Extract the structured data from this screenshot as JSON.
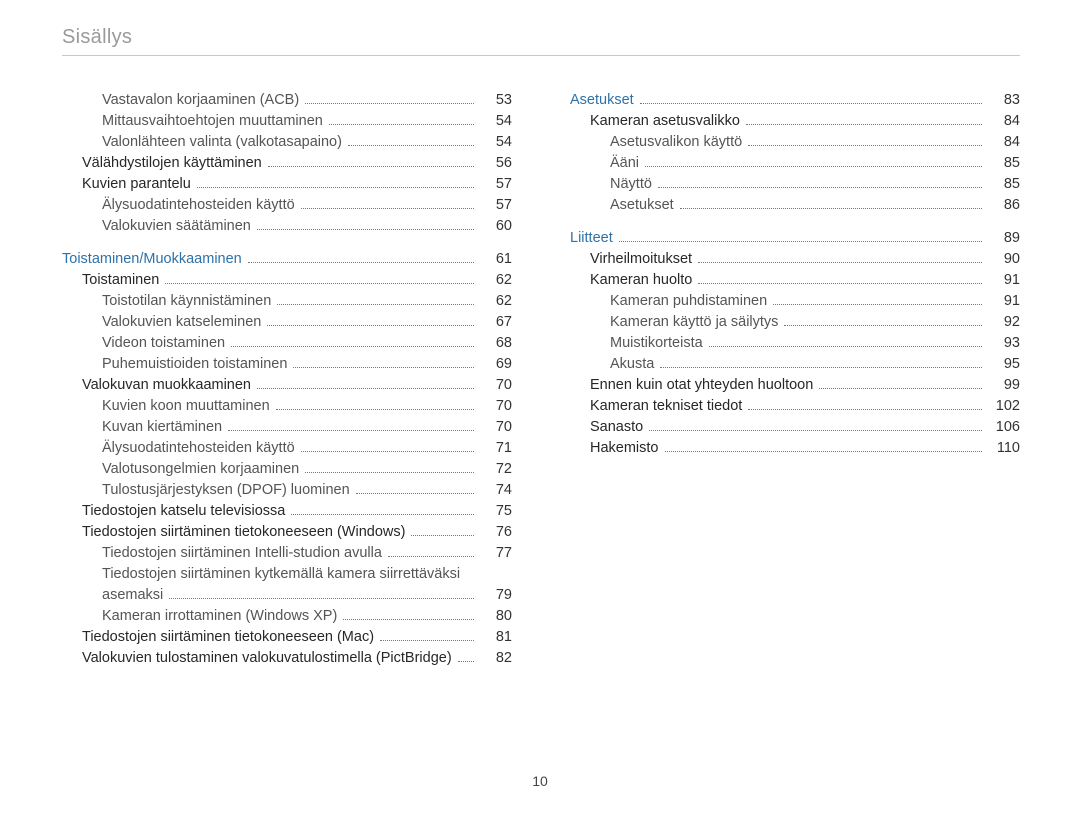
{
  "header": "Sisällys",
  "page_number": "10",
  "left": [
    {
      "level": 2,
      "label": "Vastavalon korjaaminen (ACB)",
      "page": "53"
    },
    {
      "level": 2,
      "label": "Mittausvaihtoehtojen muuttaminen",
      "page": "54"
    },
    {
      "level": 2,
      "label": "Valonlähteen valinta (valkotasapaino)",
      "page": "54"
    },
    {
      "level": 1,
      "label": "Välähdystilojen käyttäminen",
      "page": "56"
    },
    {
      "level": 1,
      "label": "Kuvien parantelu",
      "page": "57"
    },
    {
      "level": 2,
      "label": "Älysuodatintehosteiden käyttö",
      "page": "57"
    },
    {
      "level": 2,
      "label": "Valokuvien säätäminen",
      "page": "60"
    },
    {
      "spacer": true
    },
    {
      "level": 0,
      "section": true,
      "label": "Toistaminen/Muokkaaminen",
      "page": "61"
    },
    {
      "level": 1,
      "label": "Toistaminen",
      "page": "62"
    },
    {
      "level": 2,
      "label": "Toistotilan käynnistäminen",
      "page": "62"
    },
    {
      "level": 2,
      "label": "Valokuvien katseleminen",
      "page": "67"
    },
    {
      "level": 2,
      "label": "Videon toistaminen",
      "page": "68"
    },
    {
      "level": 2,
      "label": "Puhemuistioiden toistaminen",
      "page": "69"
    },
    {
      "level": 1,
      "label": "Valokuvan muokkaaminen",
      "page": "70"
    },
    {
      "level": 2,
      "label": "Kuvien koon muuttaminen",
      "page": "70"
    },
    {
      "level": 2,
      "label": "Kuvan kiertäminen",
      "page": "70"
    },
    {
      "level": 2,
      "label": "Älysuodatintehosteiden käyttö",
      "page": "71"
    },
    {
      "level": 2,
      "label": "Valotusongelmien korjaaminen",
      "page": "72"
    },
    {
      "level": 2,
      "label": "Tulostusjärjestyksen (DPOF) luominen",
      "page": "74"
    },
    {
      "level": 1,
      "label": "Tiedostojen katselu televisiossa",
      "page": "75"
    },
    {
      "level": 1,
      "label": "Tiedostojen siirtäminen tietokoneeseen (Windows)",
      "page": "76"
    },
    {
      "level": 2,
      "label": "Tiedostojen siirtäminen Intelli-studion avulla",
      "page": "77"
    },
    {
      "level": 2,
      "nopage": true,
      "label": "Tiedostojen siirtäminen kytkemällä kamera siirrettäväksi"
    },
    {
      "level": 2,
      "label": "asemaksi",
      "page": "79"
    },
    {
      "level": 2,
      "label": "Kameran irrottaminen (Windows XP)",
      "page": "80"
    },
    {
      "level": 1,
      "label": "Tiedostojen siirtäminen tietokoneeseen (Mac)",
      "page": "81"
    },
    {
      "level": 1,
      "label": "Valokuvien tulostaminen valokuvatulostimella (PictBridge)",
      "page": "82"
    }
  ],
  "right": [
    {
      "level": 0,
      "section": true,
      "label": "Asetukset",
      "page": "83"
    },
    {
      "level": 1,
      "label": "Kameran asetusvalikko",
      "page": "84"
    },
    {
      "level": 2,
      "label": "Asetusvalikon käyttö",
      "page": "84"
    },
    {
      "level": 2,
      "label": "Ääni",
      "page": "85"
    },
    {
      "level": 2,
      "label": "Näyttö",
      "page": "85"
    },
    {
      "level": 2,
      "label": "Asetukset",
      "page": "86"
    },
    {
      "spacer": true
    },
    {
      "level": 0,
      "section": true,
      "label": "Liitteet",
      "page": "89"
    },
    {
      "level": 1,
      "label": "Virheilmoitukset",
      "page": "90"
    },
    {
      "level": 1,
      "label": "Kameran huolto",
      "page": "91"
    },
    {
      "level": 2,
      "label": "Kameran puhdistaminen",
      "page": "91"
    },
    {
      "level": 2,
      "label": "Kameran käyttö ja säilytys",
      "page": "92"
    },
    {
      "level": 2,
      "label": "Muistikorteista",
      "page": "93"
    },
    {
      "level": 2,
      "label": "Akusta",
      "page": "95"
    },
    {
      "level": 1,
      "label": "Ennen kuin otat yhteyden huoltoon",
      "page": "99"
    },
    {
      "level": 1,
      "label": "Kameran tekniset tiedot",
      "page": "102"
    },
    {
      "level": 1,
      "label": "Sanasto",
      "page": "106"
    },
    {
      "level": 1,
      "label": "Hakemisto",
      "page": "110"
    }
  ]
}
